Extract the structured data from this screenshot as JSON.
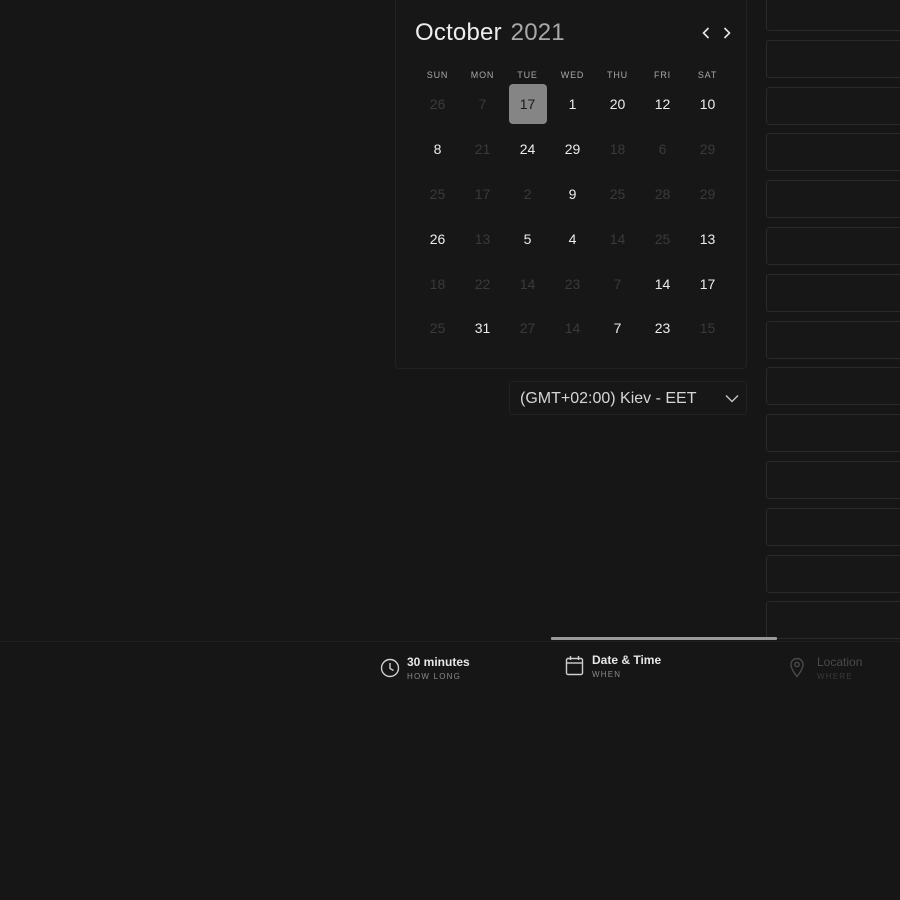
{
  "calendar": {
    "month": "October",
    "year": "2021",
    "prev_icon": "chevron-left-icon",
    "next_icon": "chevron-right-icon",
    "weekdays": [
      "SUN",
      "MON",
      "TUE",
      "WED",
      "THU",
      "FRI",
      "SAT"
    ],
    "weeks": [
      [
        {
          "d": "26",
          "in": false
        },
        {
          "d": "7",
          "in": false
        },
        {
          "d": "17",
          "in": true,
          "selected": true
        },
        {
          "d": "1",
          "in": true
        },
        {
          "d": "20",
          "in": true
        },
        {
          "d": "12",
          "in": true
        },
        {
          "d": "10",
          "in": true
        }
      ],
      [
        {
          "d": "8",
          "in": true
        },
        {
          "d": "21",
          "in": false
        },
        {
          "d": "24",
          "in": true
        },
        {
          "d": "29",
          "in": true
        },
        {
          "d": "18",
          "in": false
        },
        {
          "d": "6",
          "in": false
        },
        {
          "d": "29",
          "in": false
        }
      ],
      [
        {
          "d": "25",
          "in": false
        },
        {
          "d": "17",
          "in": false
        },
        {
          "d": "2",
          "in": false
        },
        {
          "d": "9",
          "in": true
        },
        {
          "d": "25",
          "in": false
        },
        {
          "d": "28",
          "in": false
        },
        {
          "d": "29",
          "in": false
        }
      ],
      [
        {
          "d": "26",
          "in": true
        },
        {
          "d": "13",
          "in": false
        },
        {
          "d": "5",
          "in": true
        },
        {
          "d": "4",
          "in": true
        },
        {
          "d": "14",
          "in": false
        },
        {
          "d": "25",
          "in": false
        },
        {
          "d": "13",
          "in": true
        }
      ],
      [
        {
          "d": "18",
          "in": false
        },
        {
          "d": "22",
          "in": false
        },
        {
          "d": "14",
          "in": false
        },
        {
          "d": "23",
          "in": false
        },
        {
          "d": "7",
          "in": false
        },
        {
          "d": "14",
          "in": true
        },
        {
          "d": "17",
          "in": true
        }
      ],
      [
        {
          "d": "25",
          "in": false
        },
        {
          "d": "31",
          "in": true
        },
        {
          "d": "27",
          "in": false
        },
        {
          "d": "14",
          "in": false
        },
        {
          "d": "7",
          "in": true
        },
        {
          "d": "23",
          "in": true
        },
        {
          "d": "15",
          "in": false
        }
      ]
    ]
  },
  "timezone": {
    "selected": "(GMT+02:00) Kiev - EET",
    "icon": "chevron-down-icon"
  },
  "time_slots": {
    "count_visible": 14
  },
  "steps": [
    {
      "id": "duration",
      "title": "30 minutes",
      "subtitle": "HOW LONG",
      "icon": "clock-icon",
      "state": "done"
    },
    {
      "id": "datetime",
      "title": "Date & Time",
      "subtitle": "WHEN",
      "icon": "calendar-icon",
      "state": "active"
    },
    {
      "id": "location",
      "title": "Location",
      "subtitle": "WHERE",
      "icon": "map-pin-icon",
      "state": "disabled"
    }
  ],
  "colors": {
    "background": "#161616",
    "selected_day": "#858585",
    "progress": "#9a9a9a",
    "text": "#ececec",
    "muted": "#3a3a3a"
  }
}
